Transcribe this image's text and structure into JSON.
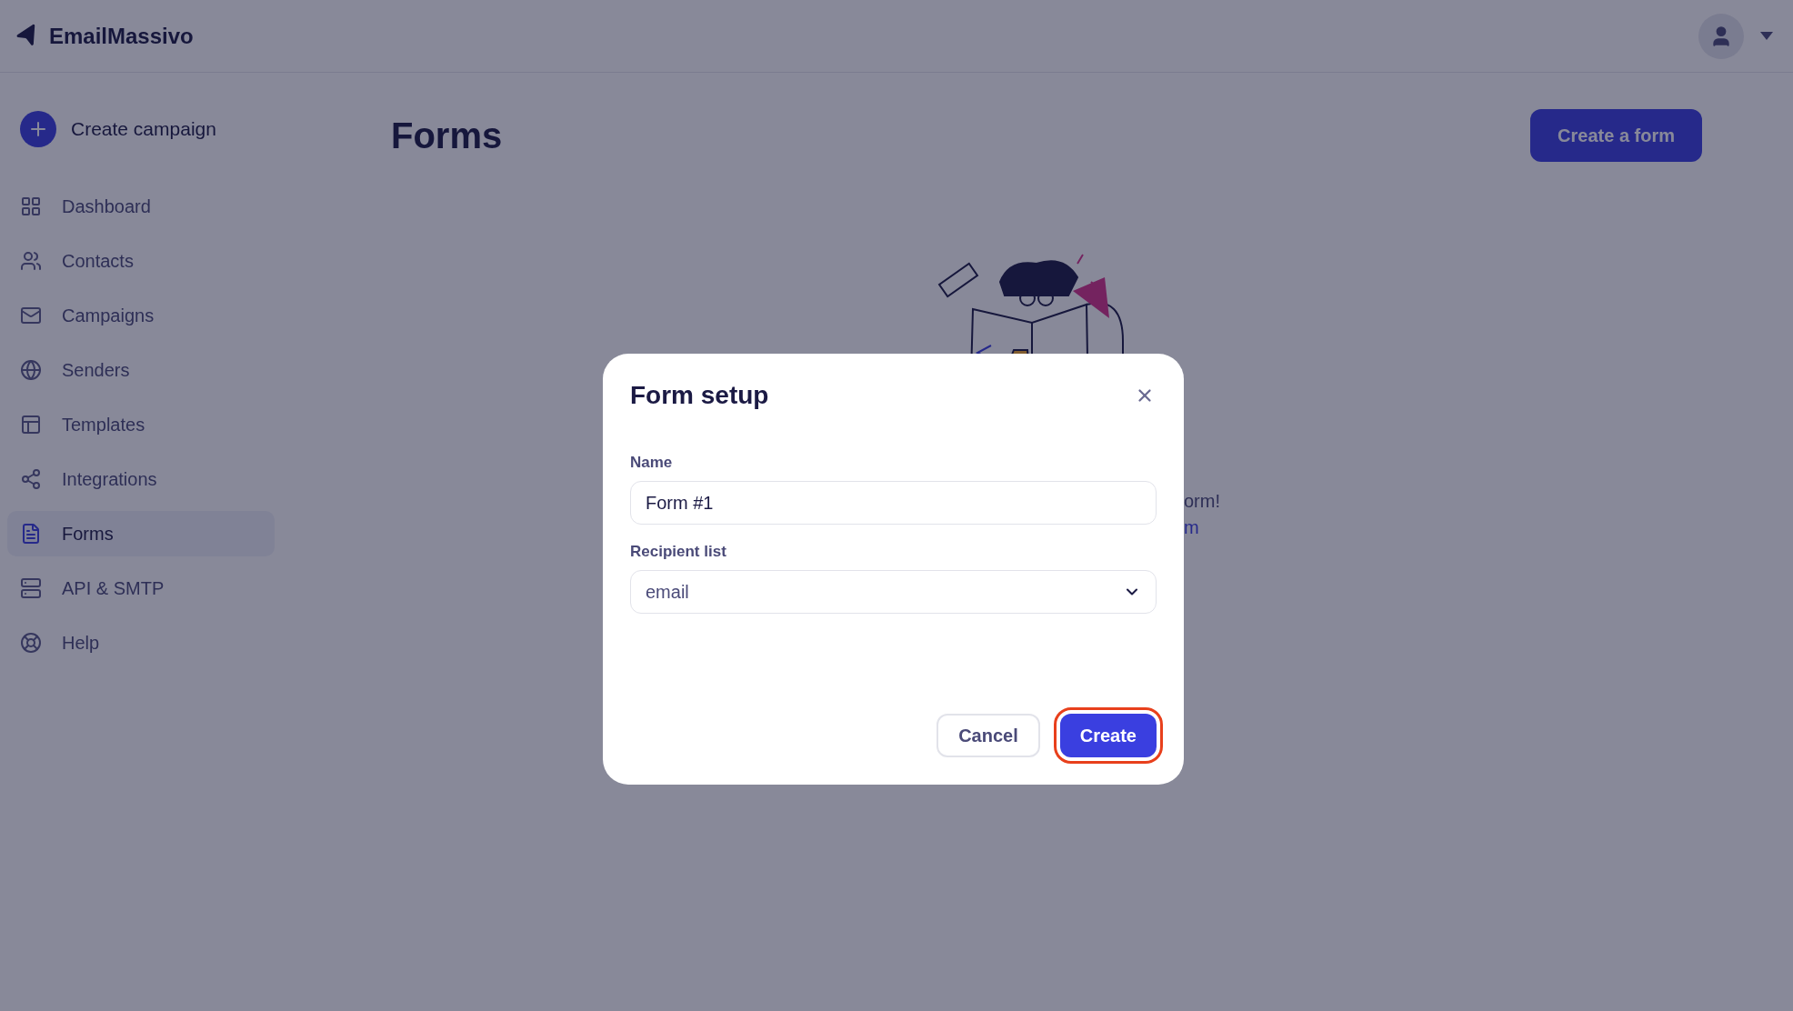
{
  "app": {
    "name": "EmailMassivo"
  },
  "sidebar": {
    "create_button": "Create campaign",
    "items": [
      {
        "label": "Dashboard",
        "selected": false
      },
      {
        "label": "Contacts",
        "selected": false
      },
      {
        "label": "Campaigns",
        "selected": false
      },
      {
        "label": "Senders",
        "selected": false
      },
      {
        "label": "Templates",
        "selected": false
      },
      {
        "label": "Integrations",
        "selected": false
      },
      {
        "label": "Forms",
        "selected": true
      },
      {
        "label": "API & SMTP",
        "selected": false
      },
      {
        "label": "Help",
        "selected": false
      }
    ]
  },
  "page": {
    "title": "Forms",
    "create_button": "Create a form",
    "empty_state": {
      "text": "orm!",
      "link": "m"
    }
  },
  "dialog": {
    "title": "Form setup",
    "fields": [
      {
        "kind": "text",
        "label": "Name",
        "value": "Form #1"
      },
      {
        "kind": "select",
        "label": "Recipient list",
        "value": "email"
      }
    ],
    "buttons": [
      {
        "label": "Cancel",
        "kind": "secondary",
        "focused": false
      },
      {
        "label": "Create",
        "kind": "primary",
        "focused": true
      }
    ]
  }
}
